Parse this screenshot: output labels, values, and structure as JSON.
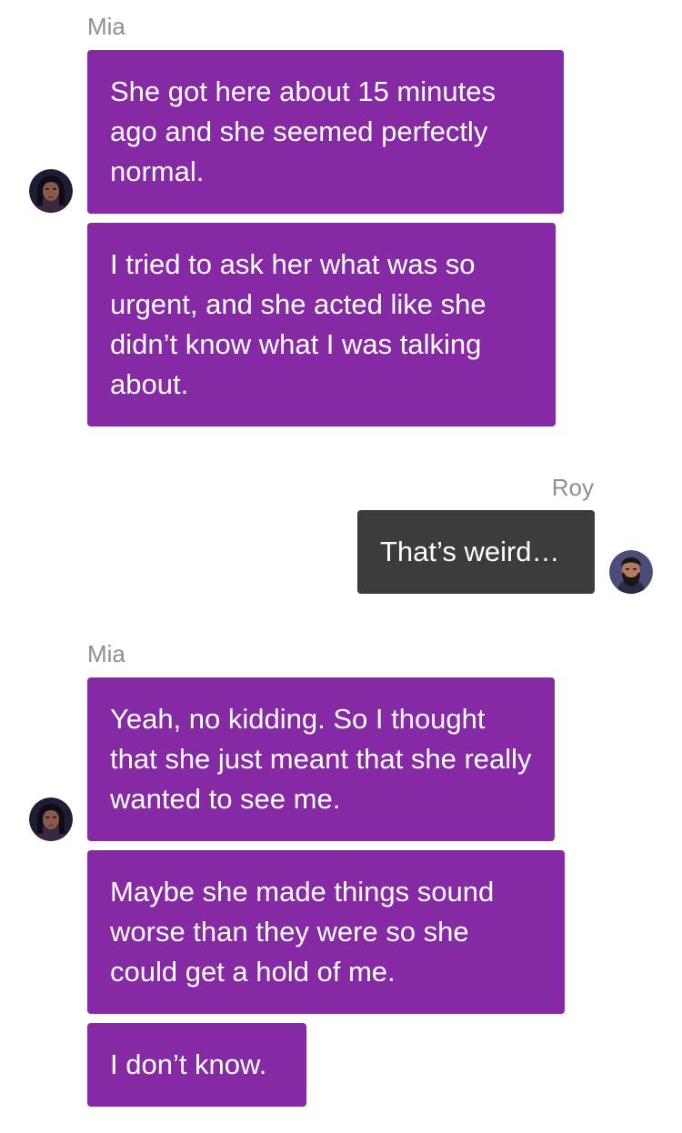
{
  "messages": [
    {
      "sender": "Mia",
      "bubbles": [
        "She got here about 15 minutes ago and she seemed perfectly normal.",
        "I tried to ask her what was so urgent, and she acted like she didn’t know what I was talking about."
      ]
    },
    {
      "sender": "Roy",
      "bubbles": [
        "That’s weird…"
      ]
    },
    {
      "sender": "Mia",
      "bubbles": [
        "Yeah, no kidding. So I thought that she just meant that she really wanted to see me.",
        "Maybe she made things sound worse than they were so she could get a hold of me.",
        "I don’t know."
      ]
    }
  ],
  "colors": {
    "incoming_bubble": "#8529a5",
    "outgoing_bubble": "#3c3c3c",
    "sender_name": "#8e8e93",
    "bubble_text": "#ffffff"
  },
  "avatars": {
    "mia": "woman-avatar-icon",
    "roy": "bearded-man-avatar-icon"
  }
}
